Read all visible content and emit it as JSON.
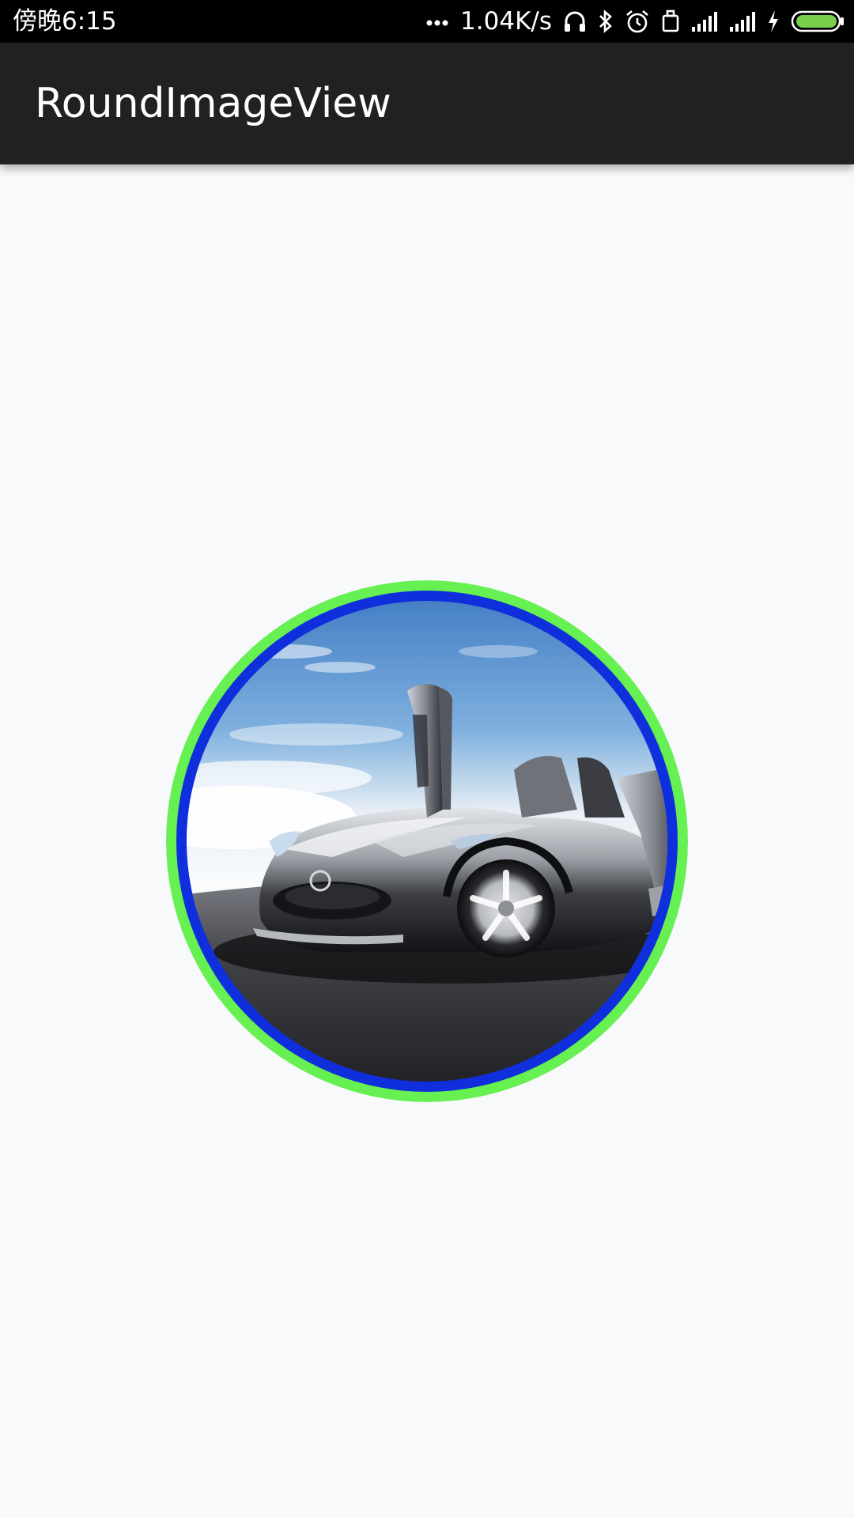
{
  "status_bar": {
    "time": "傍晚6:15",
    "dots": "...",
    "network_speed": "1.04K/s",
    "icons": [
      "headphones-icon",
      "bluetooth-icon",
      "alarm-icon",
      "sim-icon",
      "signal-icon",
      "signal-icon",
      "charging-icon",
      "battery-icon"
    ]
  },
  "app_bar": {
    "title": "RoundImageView"
  },
  "round_image": {
    "content": "car-photo",
    "outer_border_color": "#66f052",
    "inner_border_color": "#0f2edc"
  },
  "colors": {
    "status_bar_bg": "#000000",
    "app_bar_bg": "#212121",
    "page_bg": "#f8f9fa",
    "battery_fill": "#7ad04a"
  }
}
